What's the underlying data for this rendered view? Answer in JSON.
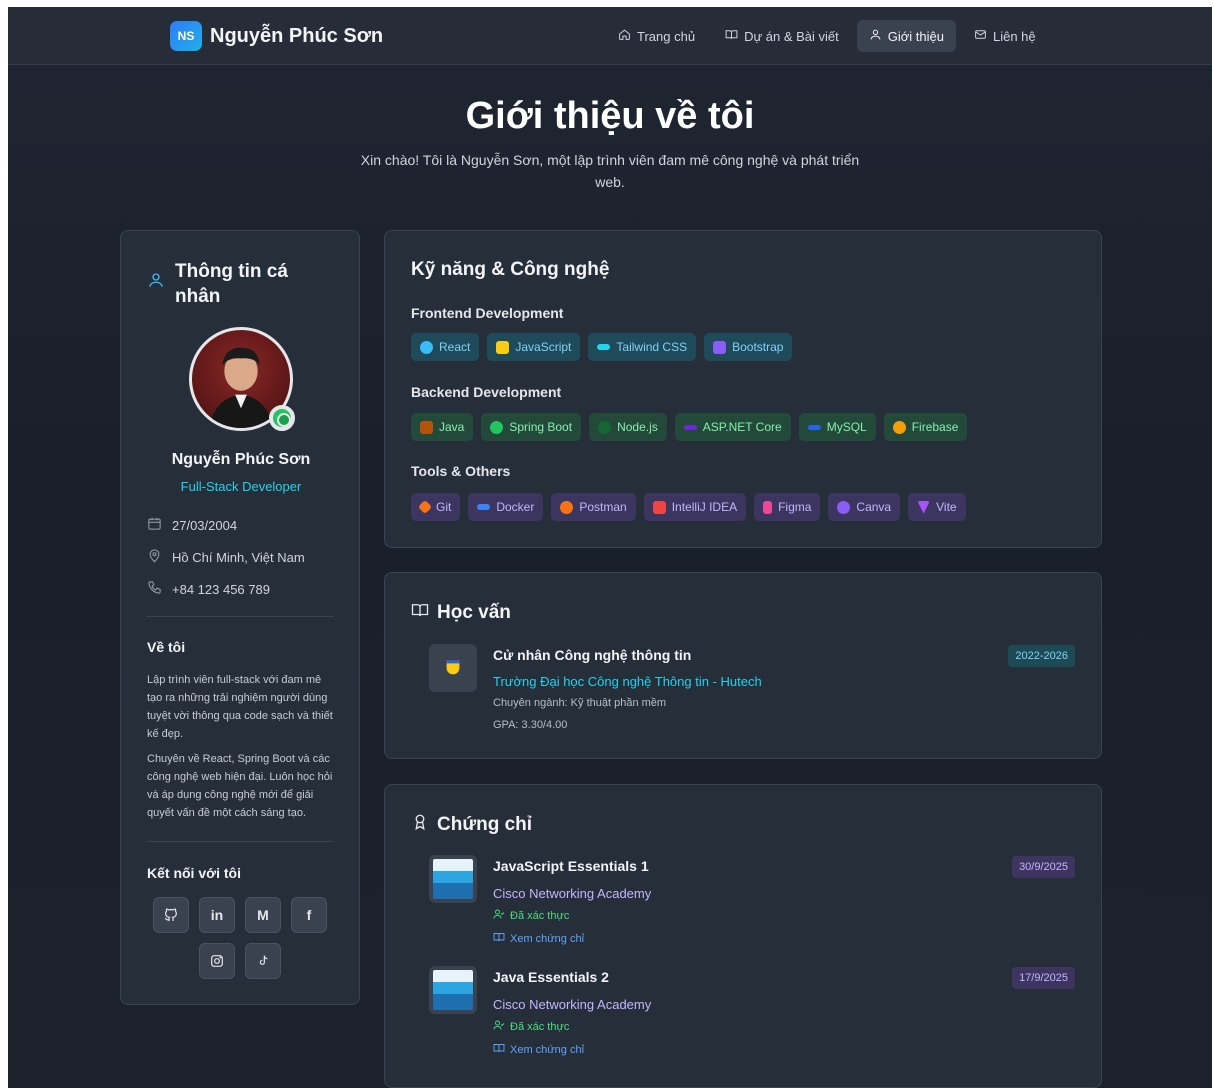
{
  "nav": {
    "logo_initials": "NS",
    "brand": "Nguyễn Phúc Sơn",
    "links": [
      {
        "label": "Trang chủ",
        "icon": "home-icon"
      },
      {
        "label": "Dự án & Bài viết",
        "icon": "book-icon"
      },
      {
        "label": "Giới thiệu",
        "icon": "user-icon",
        "active": true
      },
      {
        "label": "Liên hệ",
        "icon": "mail-icon"
      }
    ]
  },
  "hero": {
    "title": "Giới thiệu về tôi",
    "subtitle": "Xin chào! Tôi là Nguyễn Sơn, một lập trình viên đam mê công nghệ và phát triển web."
  },
  "profile": {
    "section_title": "Thông tin cá nhân",
    "name": "Nguyễn Phúc Sơn",
    "role": "Full-Stack Developer",
    "birthday": "27/03/2004",
    "location": "Hồ Chí Minh, Việt Nam",
    "phone": "+84 123 456 789",
    "about_title": "Về tôi",
    "about_p1": "Lập trình viên full-stack với đam mê tạo ra những trải nghiệm người dùng tuyệt vời thông qua code sạch và thiết kế đẹp.",
    "about_p2": "Chuyên về React, Spring Boot và các công nghệ web hiện đại. Luôn học hỏi và áp dụng công nghệ mới để giải quyết vấn đề một cách sáng tạo.",
    "connect_title": "Kết nối với tôi",
    "socials": [
      "github-icon",
      "linkedin-icon",
      "medium-icon",
      "facebook-icon",
      "instagram-icon",
      "tiktok-icon"
    ],
    "social_glyphs": {
      "linkedin": "in",
      "medium": "M",
      "facebook": "f"
    }
  },
  "skills": {
    "title": "Kỹ năng & Công nghệ",
    "frontend": {
      "label": "Frontend Development",
      "items": [
        {
          "name": "React",
          "color": "#38bdf8"
        },
        {
          "name": "JavaScript",
          "color": "#facc15"
        },
        {
          "name": "Tailwind CSS",
          "color": "#22d3ee"
        },
        {
          "name": "Bootstrap",
          "color": "#8b5cf6"
        }
      ]
    },
    "backend": {
      "label": "Backend Development",
      "items": [
        {
          "name": "Java",
          "color": "#f59e0b"
        },
        {
          "name": "Spring Boot",
          "color": "#22c55e"
        },
        {
          "name": "Node.js",
          "color": "#16a34a"
        },
        {
          "name": "ASP.NET Core",
          "color": "#7c3aed"
        },
        {
          "name": "MySQL",
          "color": "#3b82f6"
        },
        {
          "name": "Firebase",
          "color": "#f59e0b"
        }
      ]
    },
    "tools": {
      "label": "Tools & Others",
      "items": [
        {
          "name": "Git",
          "color": "#f97316"
        },
        {
          "name": "Docker",
          "color": "#3b82f6"
        },
        {
          "name": "Postman",
          "color": "#f97316"
        },
        {
          "name": "IntelliJ IDEA",
          "color": "#ef4444"
        },
        {
          "name": "Figma",
          "color": "#ec4899"
        },
        {
          "name": "Canva",
          "color": "#8b5cf6"
        },
        {
          "name": "Vite",
          "color": "#a855f7"
        }
      ]
    }
  },
  "education": {
    "title": "Học vấn",
    "degree": "Cử nhân Công nghệ thông tin",
    "school": "Trường Đại học Công nghệ Thông tin - Hutech",
    "major": "Chuyên ngành: Kỹ thuật phần mềm",
    "gpa": "GPA: 3.30/4.00",
    "years": "2022-2026"
  },
  "certificates": {
    "title": "Chứng chỉ",
    "items": [
      {
        "name": "JavaScript Essentials 1",
        "issuer": "Cisco Networking Academy",
        "verified": "Đã xác thực",
        "view": "Xem chứng chỉ",
        "date": "30/9/2025"
      },
      {
        "name": "Java Essentials 2",
        "issuer": "Cisco Networking Academy",
        "verified": "Đã xác thực",
        "view": "Xem chứng chỉ",
        "date": "17/9/2025"
      }
    ]
  }
}
